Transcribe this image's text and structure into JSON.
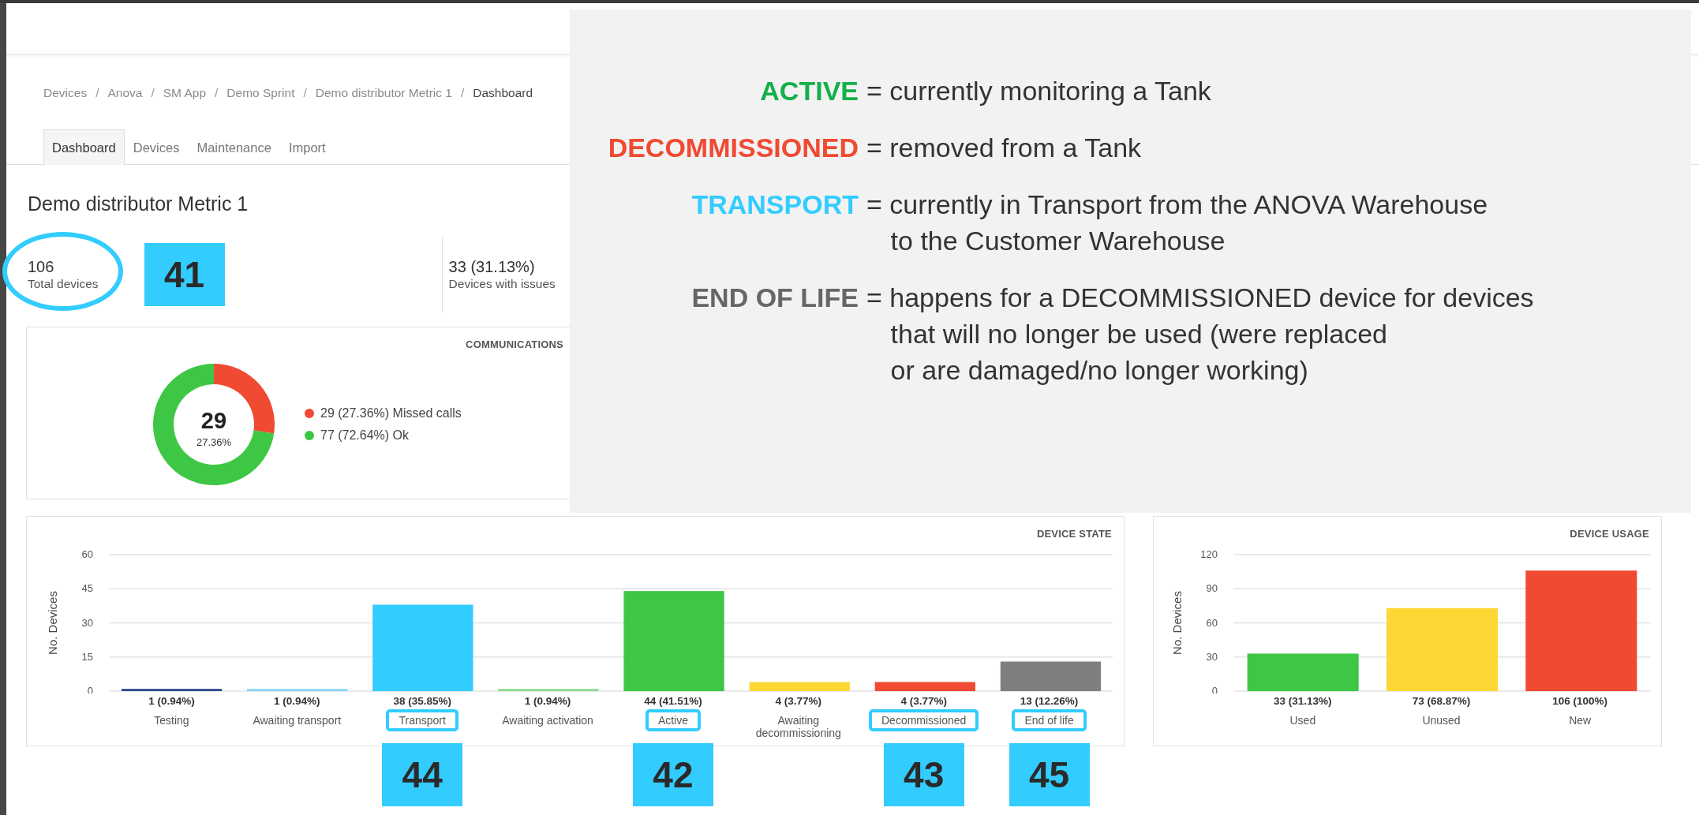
{
  "breadcrumb": [
    {
      "label": "Devices",
      "current": false
    },
    {
      "label": "Anova",
      "current": false
    },
    {
      "label": "SM App",
      "current": false
    },
    {
      "label": "Demo Sprint",
      "current": false
    },
    {
      "label": "Demo distributor Metric 1",
      "current": false
    },
    {
      "label": "Dashboard",
      "current": true
    }
  ],
  "breadcrumb_separator": "/",
  "tabs": [
    {
      "label": "Dashboard",
      "selected": true
    },
    {
      "label": "Devices",
      "selected": false
    },
    {
      "label": "Maintenance",
      "selected": false
    },
    {
      "label": "Import",
      "selected": false
    }
  ],
  "page_title": "Demo distributor Metric 1",
  "stats": [
    {
      "value": "106",
      "label": "Total devices",
      "circled": true,
      "callout": "41"
    },
    {
      "value": "33 (31.13%)",
      "label": "Devices with issues",
      "circled": false
    }
  ],
  "communications": {
    "title": "COMMUNICATIONS",
    "center_value": "29",
    "center_percent": "27.36%",
    "chart_data": {
      "type": "donut",
      "values": [
        27.36,
        72.64
      ],
      "colors": [
        "#f04a33",
        "#3ec744"
      ]
    },
    "legend": [
      {
        "text": "29 (27.36%) Missed calls",
        "color": "#f04a33"
      },
      {
        "text": "77 (72.64%) Ok",
        "color": "#3ec744"
      }
    ]
  },
  "device_state": {
    "chart_data": {
      "type": "bar",
      "title": "DEVICE STATE",
      "ylabel": "No. Devices",
      "categories": [
        "Testing",
        "Awaiting transport",
        "Transport",
        "Awaiting activation",
        "Active",
        "Awaiting decommissioning",
        "Decommissioned",
        "End of life"
      ],
      "values": [
        1,
        1,
        38,
        1,
        44,
        4,
        4,
        13
      ],
      "colors": [
        "#2f4a8f",
        "#8fd8f5",
        "#33ccff",
        "#90dc90",
        "#3ec744",
        "#fdd835",
        "#f04a33",
        "#7f7f7f"
      ],
      "ylim": [
        0,
        60
      ],
      "yticks": [
        0,
        15,
        30,
        45,
        60
      ],
      "grid": true,
      "value_labels": [
        "1 (0.94%)",
        "1 (0.94%)",
        "38 (35.85%)",
        "1 (0.94%)",
        "44 (41.51%)",
        "4 (3.77%)",
        "4 (3.77%)",
        "13 (12.26%)"
      ]
    },
    "category_marks": [
      {
        "highlighted": false
      },
      {
        "highlighted": false
      },
      {
        "highlighted": true,
        "callout": "44"
      },
      {
        "highlighted": false
      },
      {
        "highlighted": true,
        "callout": "42"
      },
      {
        "highlighted": false
      },
      {
        "highlighted": true,
        "callout": "43"
      },
      {
        "highlighted": true,
        "callout": "45"
      }
    ]
  },
  "device_usage": {
    "chart_data": {
      "type": "bar",
      "title": "DEVICE USAGE",
      "ylabel": "No. Devices",
      "categories": [
        "Used",
        "Unused",
        "New"
      ],
      "values": [
        33,
        73,
        106
      ],
      "colors": [
        "#3ec744",
        "#fdd835",
        "#f04a33"
      ],
      "ylim": [
        0,
        120
      ],
      "yticks": [
        0,
        30,
        60,
        90,
        120
      ],
      "grid": true,
      "value_labels": [
        "33 (31.13%)",
        "73 (68.87%)",
        "106 (100%)"
      ]
    }
  },
  "notes": [
    {
      "term": "ACTIVE",
      "color": "#14b04a",
      "lines": [
        "= currently monitoring a Tank"
      ]
    },
    {
      "term": "DECOMMISSIONED",
      "color": "#f04a33",
      "lines": [
        "= removed from a Tank"
      ]
    },
    {
      "term": "TRANSPORT",
      "color": "#33ccff",
      "lines": [
        "= currently in Transport from the ANOVA Warehouse",
        "to the Customer Warehouse"
      ]
    },
    {
      "term": "END OF LIFE",
      "color": "#666666",
      "lines": [
        "= happens for a DECOMMISSIONED device for devices",
        "that will no longer be used (were replaced",
        "or are damaged/no longer working)"
      ]
    }
  ]
}
